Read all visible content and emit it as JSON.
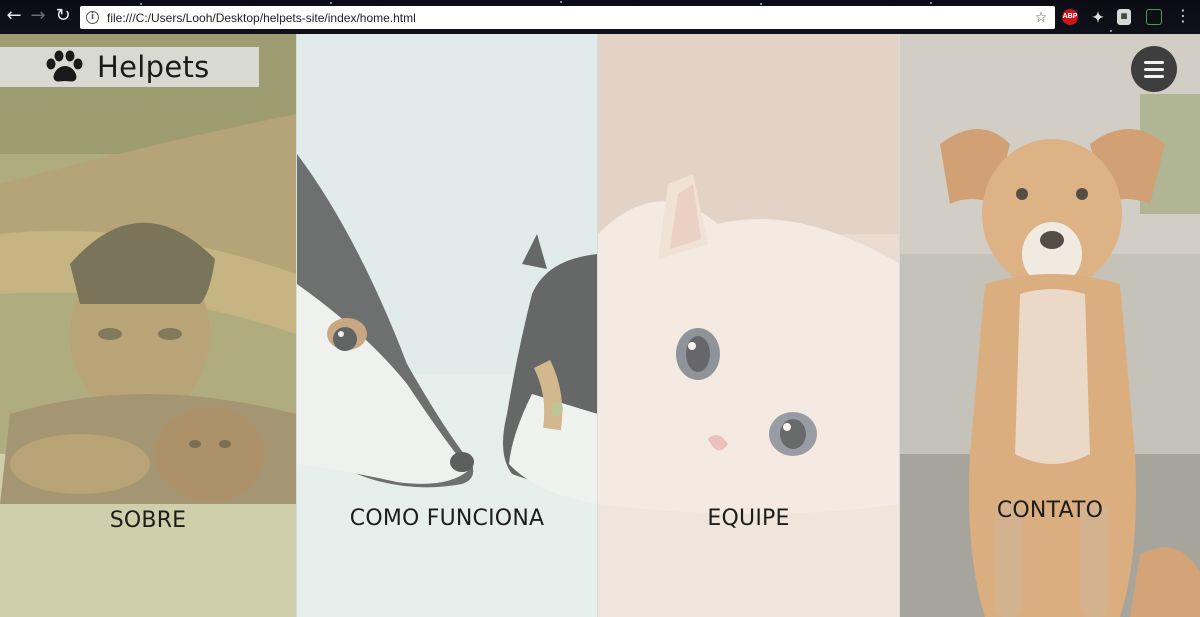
{
  "browser": {
    "url": "file:///C:/Users/Looh/Desktop/helpets-site/index/home.html",
    "extension_abp_label": "ABP"
  },
  "brand": {
    "name": "Helpets",
    "icon": "paw-icon"
  },
  "menu": {
    "icon": "hamburger-icon"
  },
  "panels": [
    {
      "label": "SOBRE",
      "image": "boy-with-puppy-photo",
      "tint": "#c7c9a0"
    },
    {
      "label": "COMO FUNCIONA",
      "image": "dog-and-cat-photo",
      "tint": "#e3ece9"
    },
    {
      "label": "EQUIPE",
      "image": "white-kitten-photo",
      "tint": "#ecdcd0"
    },
    {
      "label": "CONTATO",
      "image": "brown-puppy-photo",
      "tint": "#d9d5c8"
    }
  ]
}
